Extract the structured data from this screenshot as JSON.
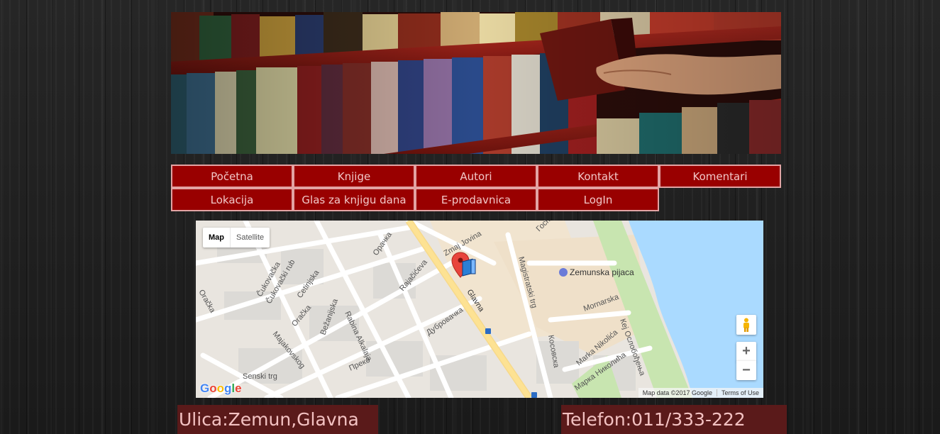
{
  "nav": {
    "row1": [
      "Početna",
      "Knjige",
      "Autori",
      "Kontakt",
      "Komentari"
    ],
    "row2": [
      "Lokacija",
      "Glas za knjigu dana",
      "E-prodavnica",
      "LogIn"
    ]
  },
  "map": {
    "type_map": "Map",
    "type_satellite": "Satellite",
    "zoom_in": "+",
    "zoom_out": "−",
    "attribution": "Map data ©2017 Google",
    "terms": "Terms of Use",
    "logo": [
      "G",
      "o",
      "o",
      "g",
      "l",
      "e"
    ],
    "labels": {
      "cukovacka": "Čukovačka",
      "cukovacki_rub": "Čukovački rub",
      "cetinjska": "Cetinjska",
      "oracka": "Oračka",
      "oracka2": "Орачка",
      "majakovskog": "Majakovskog",
      "bezanijska": "Bežanijska",
      "rabina": "Rabina Alkalaja",
      "preka": "Преко",
      "senski_trg": "Senski trg",
      "zmaj_jovina": "Zmaj Jovina",
      "rajaciceva": "Rajačićeva",
      "glavna": "Glavna",
      "dubrovacka": "Дубровачка",
      "magistratski": "Magistratski trg",
      "kosovska": "Косовска",
      "zemunska_pijaca": "Zemunska pijaca",
      "mornarska": "Mornarska",
      "marka_nikolica": "Marka Nikolića",
      "marka_nikolica2": "Марка Николића",
      "kej": "Кеј Ослобођења",
      "gospodska": "Господска",
      "left_edge": "Oračka"
    }
  },
  "contact": {
    "address": "Ulica:Zemun,Glavna",
    "phone": "Telefon:011/333-222"
  },
  "colors": {
    "nav_bg": "#990000",
    "nav_border": "#e2a3a3",
    "contact_bg": "#5a1a1a",
    "contact_text": "#f3c2c2"
  }
}
